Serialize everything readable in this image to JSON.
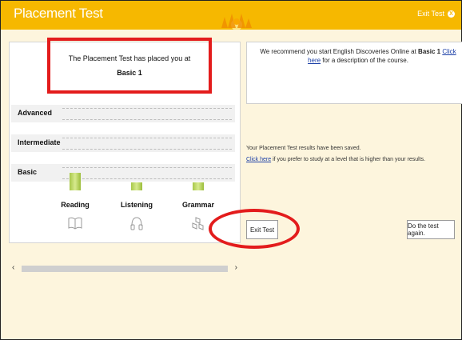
{
  "header": {
    "title": "Placement Test",
    "exit_label": "Exit Test",
    "exit_x": "X"
  },
  "result": {
    "placed_text": "The Placement Test has placed you at",
    "level": "Basic 1"
  },
  "levels": [
    {
      "label": "Advanced"
    },
    {
      "label": "Intermediate"
    },
    {
      "label": "Basic"
    }
  ],
  "skills": [
    {
      "label": "Reading",
      "icon": "book-icon"
    },
    {
      "label": "Listening",
      "icon": "headphones-icon"
    },
    {
      "label": "Grammar",
      "icon": "blocks-icon"
    }
  ],
  "recommend": {
    "before": "We recommend you start English Discoveries Online at ",
    "level": "Basic 1",
    "link": "Click here",
    "after": " for a description of the course."
  },
  "saved_text": "Your Placement Test results have been saved.",
  "higher": {
    "link": "Click here",
    "after": " if you prefer to study at a level that is higher than your results."
  },
  "buttons": {
    "exit_test": "Exit Test",
    "do_again": "Do the test again."
  },
  "scroll": {
    "left": "‹",
    "right": "›"
  },
  "colors": {
    "header": "#f6b800",
    "highlight": "#e31c1c",
    "bar": "#a8c84a",
    "link": "#1a3ea6"
  }
}
